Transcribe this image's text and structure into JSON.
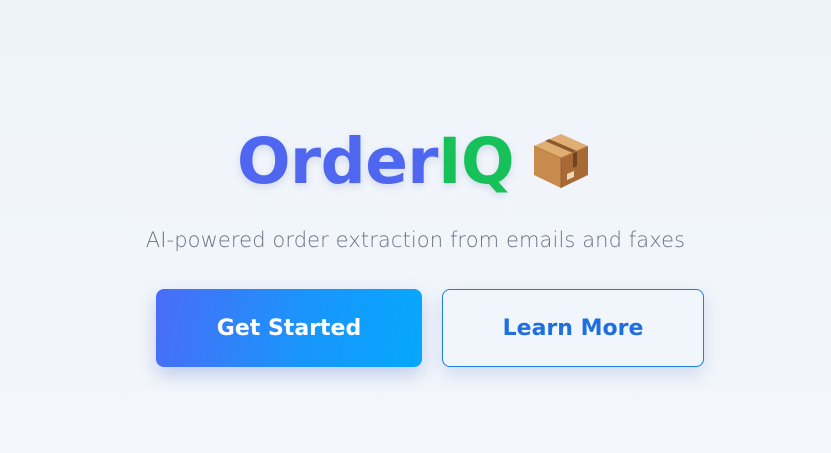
{
  "brand": {
    "name_part1": "Order",
    "name_part2": "IQ",
    "icon": "package-box-icon",
    "colors": {
      "part1": "#4f67f0",
      "part2": "#16c15a"
    }
  },
  "tagline": "AI-powered order extraction from emails and faxes",
  "actions": {
    "primary_label": "Get Started",
    "secondary_label": "Learn More"
  },
  "colors": {
    "primary_gradient_start": "#4a6cf7",
    "primary_gradient_end": "#05a8fd",
    "secondary_accent": "#1e7de6",
    "background": "#f2f6fb"
  }
}
